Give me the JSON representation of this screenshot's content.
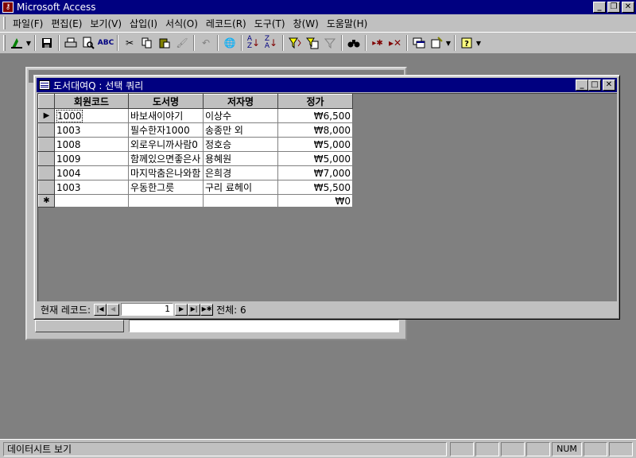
{
  "app": {
    "title": "Microsoft Access"
  },
  "menu": {
    "items": [
      "파일(F)",
      "편집(E)",
      "보기(V)",
      "삽입(I)",
      "서식(O)",
      "레코드(R)",
      "도구(T)",
      "창(W)",
      "도움말(H)"
    ]
  },
  "toolbar": {
    "icons": [
      "design-view-icon",
      "save-icon",
      "print-icon",
      "print-preview-icon",
      "spelling-icon",
      "cut-icon",
      "copy-icon",
      "paste-icon",
      "format-painter-icon",
      "undo-icon",
      "hyperlink-icon",
      "sort-ascending-icon",
      "sort-descending-icon",
      "filter-by-selection-icon",
      "filter-by-form-icon",
      "apply-filter-icon",
      "find-icon",
      "new-record-icon",
      "delete-record-icon",
      "database-window-icon",
      "new-object-icon",
      "help-icon"
    ]
  },
  "query_window": {
    "title": "도서대여Q : 선택 쿼리",
    "columns": [
      "회원코드",
      "도서명",
      "저자명",
      "정가"
    ],
    "rows": [
      {
        "code": "1000",
        "title": "바보새이야기",
        "author": "이상수",
        "price": "₩6,500"
      },
      {
        "code": "1003",
        "title": "필수한자1000",
        "author": "송종만 외",
        "price": "₩8,000"
      },
      {
        "code": "1008",
        "title": "외로우니까사람0",
        "author": "정호승",
        "price": "₩5,000"
      },
      {
        "code": "1009",
        "title": "함께있으면좋은사",
        "author": "용혜원",
        "price": "₩5,000"
      },
      {
        "code": "1004",
        "title": "마지막춤은나와함",
        "author": "은희경",
        "price": "₩7,000"
      },
      {
        "code": "1003",
        "title": "우동한그릇",
        "author": "구리 료헤이",
        "price": "₩5,500"
      }
    ],
    "new_row": {
      "price": "₩0"
    },
    "navigation": {
      "label": "현재 레코드:",
      "current": "1",
      "total_label": "전체: 6"
    }
  },
  "statusbar": {
    "text": "데이터시트 보기",
    "num": "NUM"
  },
  "colors": {
    "title_active": "#000080",
    "face": "#c0c0c0",
    "workspace": "#808080"
  }
}
